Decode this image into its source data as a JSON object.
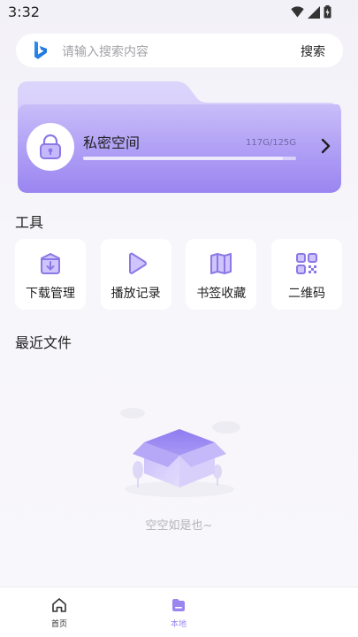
{
  "status_bar": {
    "time": "3:32"
  },
  "search": {
    "placeholder": "请输入搜索内容",
    "button_label": "搜索"
  },
  "private_space": {
    "title": "私密空间",
    "storage": "117G/125G",
    "used_fraction": 0.936
  },
  "tools_section": {
    "title": "工具",
    "items": [
      {
        "label": "下载管理",
        "icon": "download-box-icon"
      },
      {
        "label": "播放记录",
        "icon": "play-icon"
      },
      {
        "label": "书签收藏",
        "icon": "map-bookmark-icon"
      },
      {
        "label": "二维码",
        "icon": "qr-code-icon"
      }
    ]
  },
  "recent_files": {
    "title": "最近文件",
    "empty_text": "空空如是也~"
  },
  "bottom_nav": {
    "items": [
      {
        "label": "首页",
        "icon": "home-icon",
        "active": false
      },
      {
        "label": "本地",
        "icon": "folder-icon",
        "active": true
      }
    ]
  },
  "colors": {
    "accent": "#9b86f0",
    "accent_dark": "#8a73ec",
    "nav_active": "#9b86f0",
    "nav_inactive": "#333333"
  }
}
